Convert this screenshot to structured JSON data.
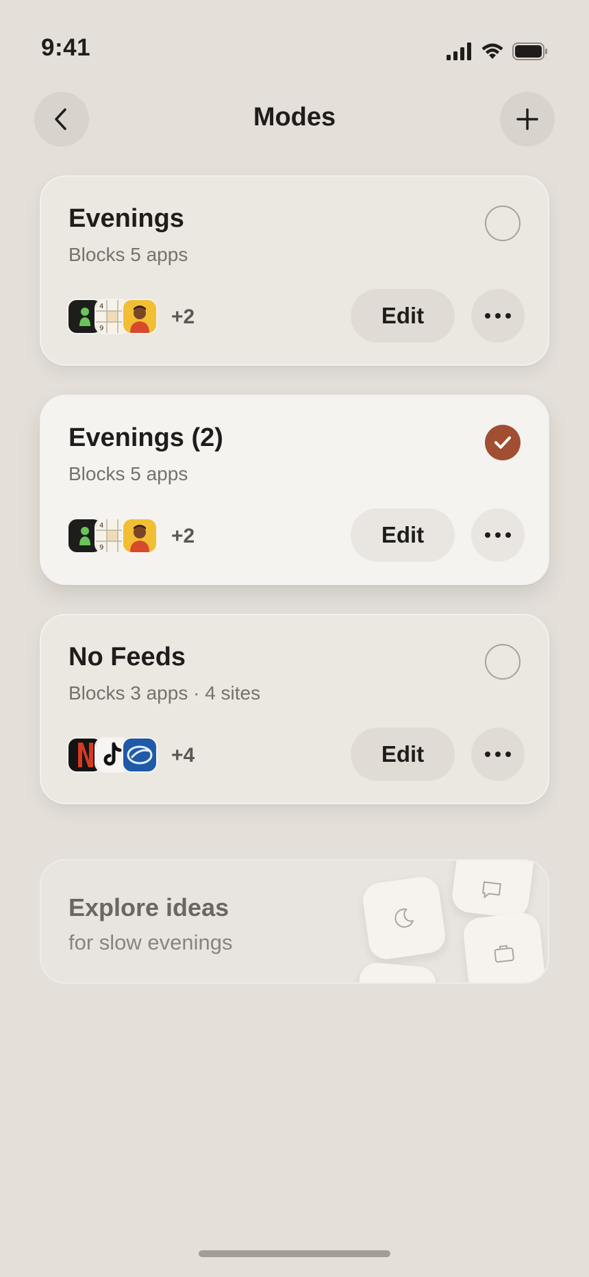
{
  "status_bar": {
    "time": "9:41"
  },
  "nav": {
    "title": "Modes"
  },
  "modes": [
    {
      "title": "Evenings",
      "subtitle": "Blocks 5 apps",
      "more": "+2",
      "edit_label": "Edit",
      "selected": false
    },
    {
      "title": "Evenings (2)",
      "subtitle": "Blocks 5 apps",
      "more": "+2",
      "edit_label": "Edit",
      "selected": true
    },
    {
      "title": "No Feeds",
      "subtitle": "Blocks 3 apps · 4 sites",
      "more": "+4",
      "edit_label": "Edit",
      "selected": false
    }
  ],
  "explore": {
    "title": "Explore ideas",
    "subtitle": "for slow evenings"
  },
  "colors": {
    "accent": "#a04f32",
    "background": "#e4dfd9"
  },
  "icons": [
    "back-icon",
    "plus-icon",
    "checkmark-icon",
    "more-icon",
    "moon-icon",
    "chat-icon",
    "briefcase-icon"
  ]
}
